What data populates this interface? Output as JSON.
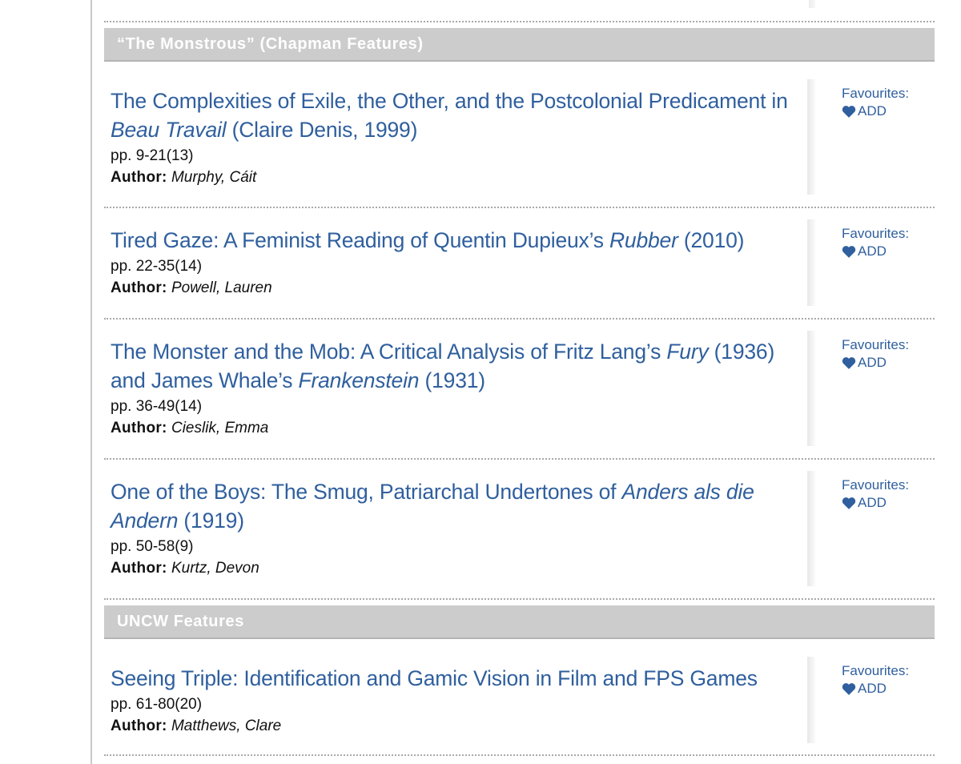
{
  "sections": [
    {
      "header": "“The Monstrous” (Chapman Features)",
      "articles": [
        {
          "title_parts": [
            "The Complexities of Exile, the Other, and the Postcolonial Predicament in ",
            "Beau Travail",
            " (Claire Denis, 1999)"
          ],
          "pages": "pp. 9-21(13)",
          "author_label": "Author:",
          "author": "Murphy, Cáit"
        },
        {
          "title_parts": [
            "Tired Gaze: A Feminist Reading of Quentin Dupieux’s ",
            "Rubber",
            " (2010)"
          ],
          "pages": "pp. 22-35(14)",
          "author_label": "Author:",
          "author": "Powell, Lauren"
        },
        {
          "title_parts": [
            "The Monster and the Mob: A Critical Analysis of Fritz Lang’s ",
            "Fury",
            " (1936) and James Whale’s ",
            "Frankenstein",
            " (1931)"
          ],
          "pages": "pp. 36-49(14)",
          "author_label": "Author:",
          "author": "Cieslik, Emma"
        },
        {
          "title_parts": [
            "One of the Boys: The Smug, Patriarchal Undertones of ",
            "Anders als die Andern",
            " (1919)"
          ],
          "pages": "pp. 50-58(9)",
          "author_label": "Author:",
          "author": "Kurtz, Devon"
        }
      ]
    },
    {
      "header": "UNCW Features",
      "articles": [
        {
          "title_parts": [
            "Seeing Triple: Identification and Gamic Vision in Film and FPS Games"
          ],
          "pages": "pp. 61-80(20)",
          "author_label": "Author:",
          "author": "Matthews, Clare"
        }
      ]
    }
  ],
  "favourites": {
    "label": "Favourites:",
    "add_label": "ADD",
    "icon": "heart-icon"
  },
  "colors": {
    "link": "#2f5f9e",
    "header_bg": "#cccccc",
    "header_text": "#ffffff"
  }
}
